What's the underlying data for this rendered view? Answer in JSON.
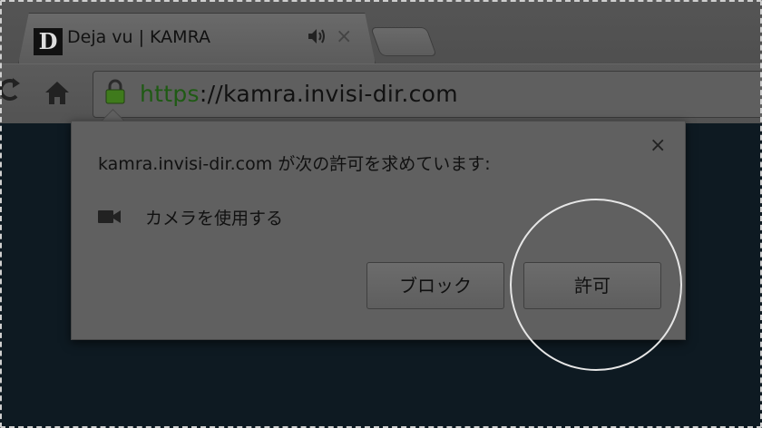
{
  "tab": {
    "favicon_letter": "D",
    "title": "Deja vu | KAMRA",
    "audio_icon": "speaker-icon",
    "close_label": "×"
  },
  "toolbar": {
    "reload_icon": "reload-icon",
    "home_icon": "home-icon",
    "lock_icon": "lock-icon"
  },
  "omnibox": {
    "scheme": "https",
    "rest": "://kamra.invisi-dir.com"
  },
  "permission_bubble": {
    "message": "kamra.invisi-dir.com が次の許可を求めています:",
    "permission_icon": "camera-icon",
    "permission_label": "カメラを使用する",
    "close_label": "×",
    "block_button": "ブロック",
    "allow_button": "許可"
  },
  "colors": {
    "secure_scheme": "#1f5a14",
    "page_background": "#0e1a22"
  }
}
